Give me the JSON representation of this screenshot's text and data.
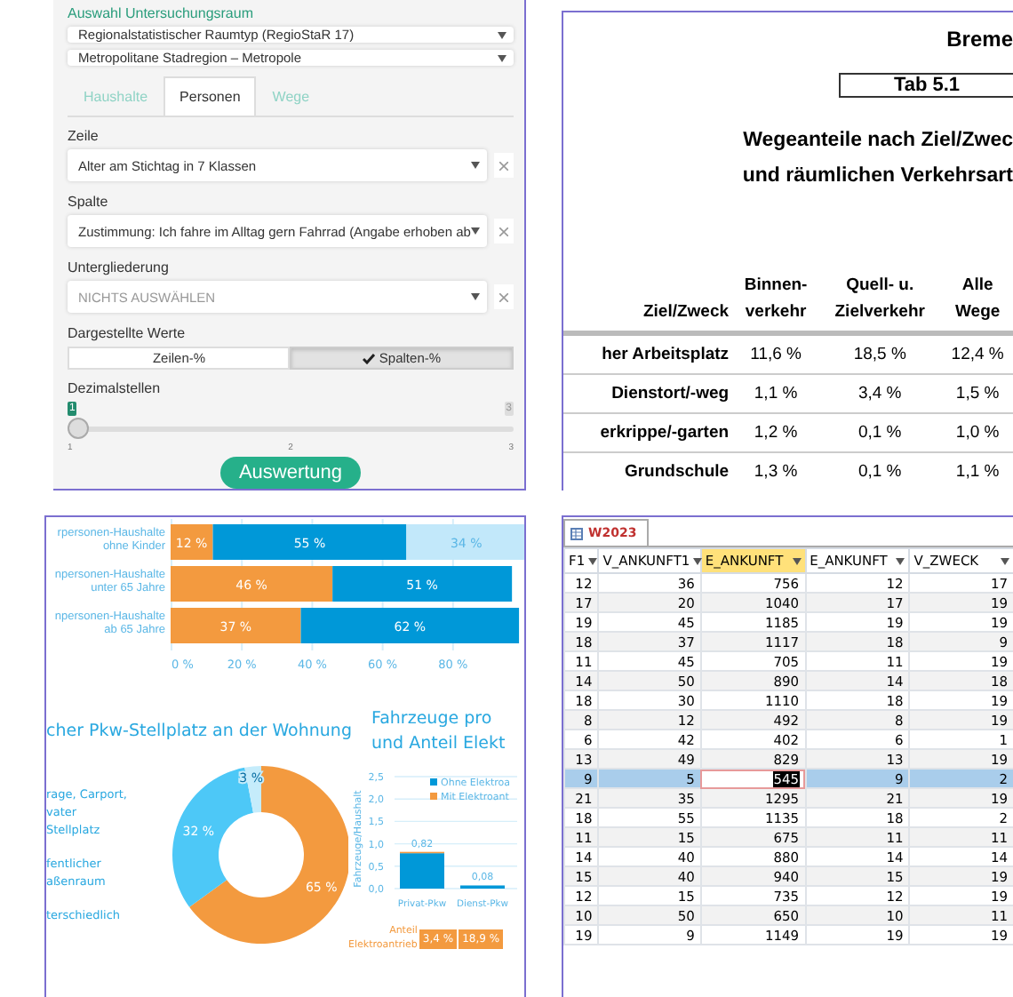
{
  "filter_panel": {
    "heading": "Auswahl Untersuchungsraum",
    "region_selects": [
      {
        "value": "Regionalstatistischer Raumtyp (RegioStaR 17)"
      },
      {
        "value": "Metropolitane Stadregion – Metropole"
      }
    ],
    "tabs": [
      {
        "label": "Haushalte",
        "selected": false
      },
      {
        "label": "Personen",
        "selected": true
      },
      {
        "label": "Wege",
        "selected": false
      }
    ],
    "fields": [
      {
        "label": "Zeile",
        "value": "Alter am Stichtag in 7 Klassen"
      },
      {
        "label": "Spalte",
        "value": "Zustimmung: Ich fahre im Alltag gern Fahrrad (Angabe erhoben ab"
      },
      {
        "label": "Untergliederung",
        "placeholder": "NICHTS AUSWÄHLEN"
      }
    ],
    "display_values": {
      "label": "Dargestellte Werte",
      "options": [
        {
          "label": "Zeilen-%",
          "selected": false
        },
        {
          "label": "Spalten-%",
          "selected": true
        }
      ]
    },
    "decimals": {
      "label": "Dezimalstellen",
      "value": "1",
      "max": "3",
      "ticks": [
        "1",
        "2",
        "3"
      ],
      "level": 0
    },
    "submit": "Auswertung"
  },
  "report": {
    "heading": "Breme",
    "table_number": "Tab 5.1",
    "title_lines": [
      "Wegeanteile nach Ziel/Zwec",
      "und räumlichen Verkehrsart"
    ],
    "columns": [
      "Ziel/Zweck",
      "Binnen-\nverkehr",
      "Quell- u.\nZielverkehr",
      "Alle\nWege"
    ],
    "rows": [
      [
        "her Arbeitsplatz",
        "11,6 %",
        "18,5 %",
        "12,4 %"
      ],
      [
        "Dienstort/-weg",
        "1,1 %",
        "3,4 %",
        "1,5 %"
      ],
      [
        "erkrippe/-garten",
        "1,2 %",
        "0,1 %",
        "1,0 %"
      ],
      [
        "Grundschule",
        "1,3 %",
        "0,1 %",
        "1,1 %"
      ]
    ]
  },
  "charts": {
    "household_bars": {
      "chart_data": {
        "type": "bar",
        "orientation": "horizontal",
        "stacked": true,
        "grid": true,
        "categories": [
          "rpersonen-Haushalte\nohne Kinder",
          "npersonen-Haushalte\nunter 65 Jahre",
          "npersonen-Haushalte\nab 65 Jahre"
        ],
        "xlim": [
          0,
          101
        ],
        "xticks": [
          {
            "value": 0,
            "label": "0 %"
          },
          {
            "value": 20,
            "label": "20 %"
          },
          {
            "value": 40,
            "label": "40 %"
          },
          {
            "value": 60,
            "label": "60 %"
          },
          {
            "value": 80,
            "label": "80 %"
          }
        ],
        "series": [
          {
            "color": "#f39a3f",
            "values": [
              12,
              46,
              37
            ],
            "value_labels": [
              "12 %",
              "46 %",
              "37 %"
            ]
          },
          {
            "color": "#0098d8",
            "values": [
              55,
              51,
              62
            ],
            "value_labels": [
              "55 %",
              "51 %",
              "62 %"
            ]
          },
          {
            "color": "#c2e8fa",
            "values": [
              34,
              null,
              null
            ],
            "value_labels": [
              "34 %",
              null,
              null
            ]
          }
        ]
      }
    },
    "parking_donut": {
      "chart_data": {
        "type": "donut",
        "title": "cher Pkw-Stellplatz an der Wohnung",
        "categories": [
          "rage, Carport,\nvater Stellplatz",
          "fentlicher\naßenraum",
          "terschiedlich"
        ],
        "values": [
          65,
          32,
          3
        ],
        "colors": [
          "#f39a3f",
          "#4dc8f7",
          "#c5ecfb"
        ],
        "value_labels": [
          "65 %",
          "32 %",
          "3 %"
        ]
      }
    },
    "vehicles": {
      "title_lines": [
        "Fahrzeuge pro",
        "und Anteil Elekt"
      ],
      "chart_data": {
        "type": "bar",
        "stacked": true,
        "grid": true,
        "legend": true,
        "ylabel": "Fahrzeuge/Haushalt",
        "categories": [
          "Privat-Pkw",
          "Dienst-Pkw"
        ],
        "ylim": [
          0,
          2.5
        ],
        "yticks": [
          {
            "value": 0,
            "label": "0,0"
          },
          {
            "value": 0.5,
            "label": "0,5"
          },
          {
            "value": 1,
            "label": "1,0"
          },
          {
            "value": 1.5,
            "label": "1,5"
          },
          {
            "value": 2,
            "label": "2,0"
          },
          {
            "value": 2.5,
            "label": "2,5"
          }
        ],
        "series": [
          {
            "name": "Ohne Elektroa",
            "color": "#0098d8",
            "values": [
              0.79,
              0.07
            ]
          },
          {
            "name": "Mit Elektroant",
            "color": "#f39a3f",
            "values": [
              0.03,
              null
            ]
          }
        ],
        "value_labels": [
          "0,82",
          "0,08"
        ]
      },
      "share_label": "Anteil\nElektroantrieb",
      "shares": [
        "3,4 %",
        "18,9 %"
      ]
    }
  },
  "datasheet": {
    "tab": "W2023",
    "columns": [
      {
        "label": "F1",
        "selected": false
      },
      {
        "label": "V_ANKUNFT1",
        "selected": false
      },
      {
        "label": "E_ANKUNFT",
        "selected": true
      },
      {
        "label": "E_ANKUNFT",
        "selected": false
      },
      {
        "label": "V_ZWECK",
        "selected": false
      }
    ],
    "rows": [
      {
        "cells": [
          "12",
          "36",
          "756",
          "12",
          "17"
        ],
        "selected": false
      },
      {
        "cells": [
          "17",
          "20",
          "1040",
          "17",
          "19"
        ],
        "selected": false
      },
      {
        "cells": [
          "19",
          "45",
          "1185",
          "19",
          "19"
        ],
        "selected": false
      },
      {
        "cells": [
          "18",
          "37",
          "1117",
          "18",
          "9"
        ],
        "selected": false
      },
      {
        "cells": [
          "11",
          "45",
          "705",
          "11",
          "19"
        ],
        "selected": false
      },
      {
        "cells": [
          "14",
          "50",
          "890",
          "14",
          "18"
        ],
        "selected": false
      },
      {
        "cells": [
          "18",
          "30",
          "1110",
          "18",
          "19"
        ],
        "selected": false
      },
      {
        "cells": [
          "8",
          "12",
          "492",
          "8",
          "19"
        ],
        "selected": false
      },
      {
        "cells": [
          "6",
          "42",
          "402",
          "6",
          "1"
        ],
        "selected": false
      },
      {
        "cells": [
          "13",
          "49",
          "829",
          "13",
          "19"
        ],
        "selected": false
      },
      {
        "cells": [
          "9",
          "5",
          "545",
          "9",
          "2"
        ],
        "selected": true
      },
      {
        "cells": [
          "21",
          "35",
          "1295",
          "21",
          "19"
        ],
        "selected": false
      },
      {
        "cells": [
          "18",
          "55",
          "1135",
          "18",
          "2"
        ],
        "selected": false
      },
      {
        "cells": [
          "11",
          "15",
          "675",
          "11",
          "11"
        ],
        "selected": false
      },
      {
        "cells": [
          "14",
          "40",
          "880",
          "14",
          "14"
        ],
        "selected": false
      },
      {
        "cells": [
          "15",
          "40",
          "940",
          "15",
          "19"
        ],
        "selected": false
      },
      {
        "cells": [
          "12",
          "15",
          "735",
          "12",
          "19"
        ],
        "selected": false
      },
      {
        "cells": [
          "10",
          "50",
          "650",
          "10",
          "11"
        ],
        "selected": false
      },
      {
        "cells": [
          "19",
          "9",
          "1149",
          "19",
          "19"
        ],
        "selected": false
      }
    ]
  }
}
